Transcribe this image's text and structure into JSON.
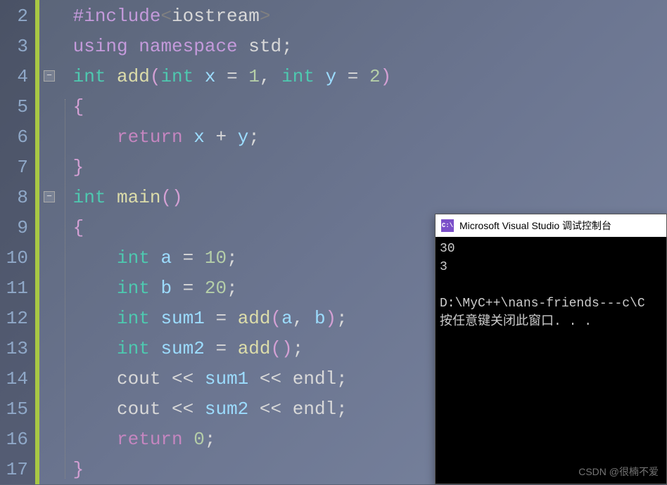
{
  "gutter": {
    "lines": [
      "2",
      "3",
      "4",
      "5",
      "6",
      "7",
      "8",
      "9",
      "10",
      "11",
      "12",
      "13",
      "14",
      "15",
      "16",
      "17"
    ]
  },
  "code": {
    "l2_include": "#include",
    "l2_open": "<",
    "l2_lib": "iostream",
    "l2_close": ">",
    "l3_using": "using",
    "l3_namespace": "namespace",
    "l3_std": "std",
    "l3_semi": ";",
    "l4_int": "int",
    "l4_add": "add",
    "l4_lp": "(",
    "l4_int2": "int",
    "l4_x": "x",
    "l4_eq": "=",
    "l4_1": "1",
    "l4_comma": ",",
    "l4_int3": "int",
    "l4_y": "y",
    "l4_eq2": "=",
    "l4_2": "2",
    "l4_rp": ")",
    "l5_lb": "{",
    "l6_return": "return",
    "l6_x": "x",
    "l6_plus": "+",
    "l6_y": "y",
    "l6_semi": ";",
    "l7_rb": "}",
    "l8_int": "int",
    "l8_main": "main",
    "l8_lp": "(",
    "l8_rp": ")",
    "l9_lb": "{",
    "l10_int": "int",
    "l10_a": "a",
    "l10_eq": "=",
    "l10_10": "10",
    "l10_semi": ";",
    "l11_int": "int",
    "l11_b": "b",
    "l11_eq": "=",
    "l11_20": "20",
    "l11_semi": ";",
    "l12_int": "int",
    "l12_sum1": "sum1",
    "l12_eq": "=",
    "l12_add": "add",
    "l12_lp": "(",
    "l12_a": "a",
    "l12_comma": ",",
    "l12_b": "b",
    "l12_rp": ")",
    "l12_semi": ";",
    "l13_int": "int",
    "l13_sum2": "sum2",
    "l13_eq": "=",
    "l13_add": "add",
    "l13_lp": "(",
    "l13_rp": ")",
    "l13_semi": ";",
    "l14_cout": "cout",
    "l14_ll1": "<<",
    "l14_sum1": "sum1",
    "l14_ll2": "<<",
    "l14_endl": "endl",
    "l14_semi": ";",
    "l15_cout": "cout",
    "l15_ll1": "<<",
    "l15_sum2": "sum2",
    "l15_ll2": "<<",
    "l15_endl": "endl",
    "l15_semi": ";",
    "l16_return": "return",
    "l16_0": "0",
    "l16_semi": ";",
    "l17_rb": "}"
  },
  "console": {
    "title": "Microsoft Visual Studio 调试控制台",
    "icon_text": "C:\\",
    "output": "30\n3\n\nD:\\MyC++\\nans-friends---c\\C\n按任意键关闭此窗口. . ."
  },
  "watermark": "CSDN @很楠不爱"
}
